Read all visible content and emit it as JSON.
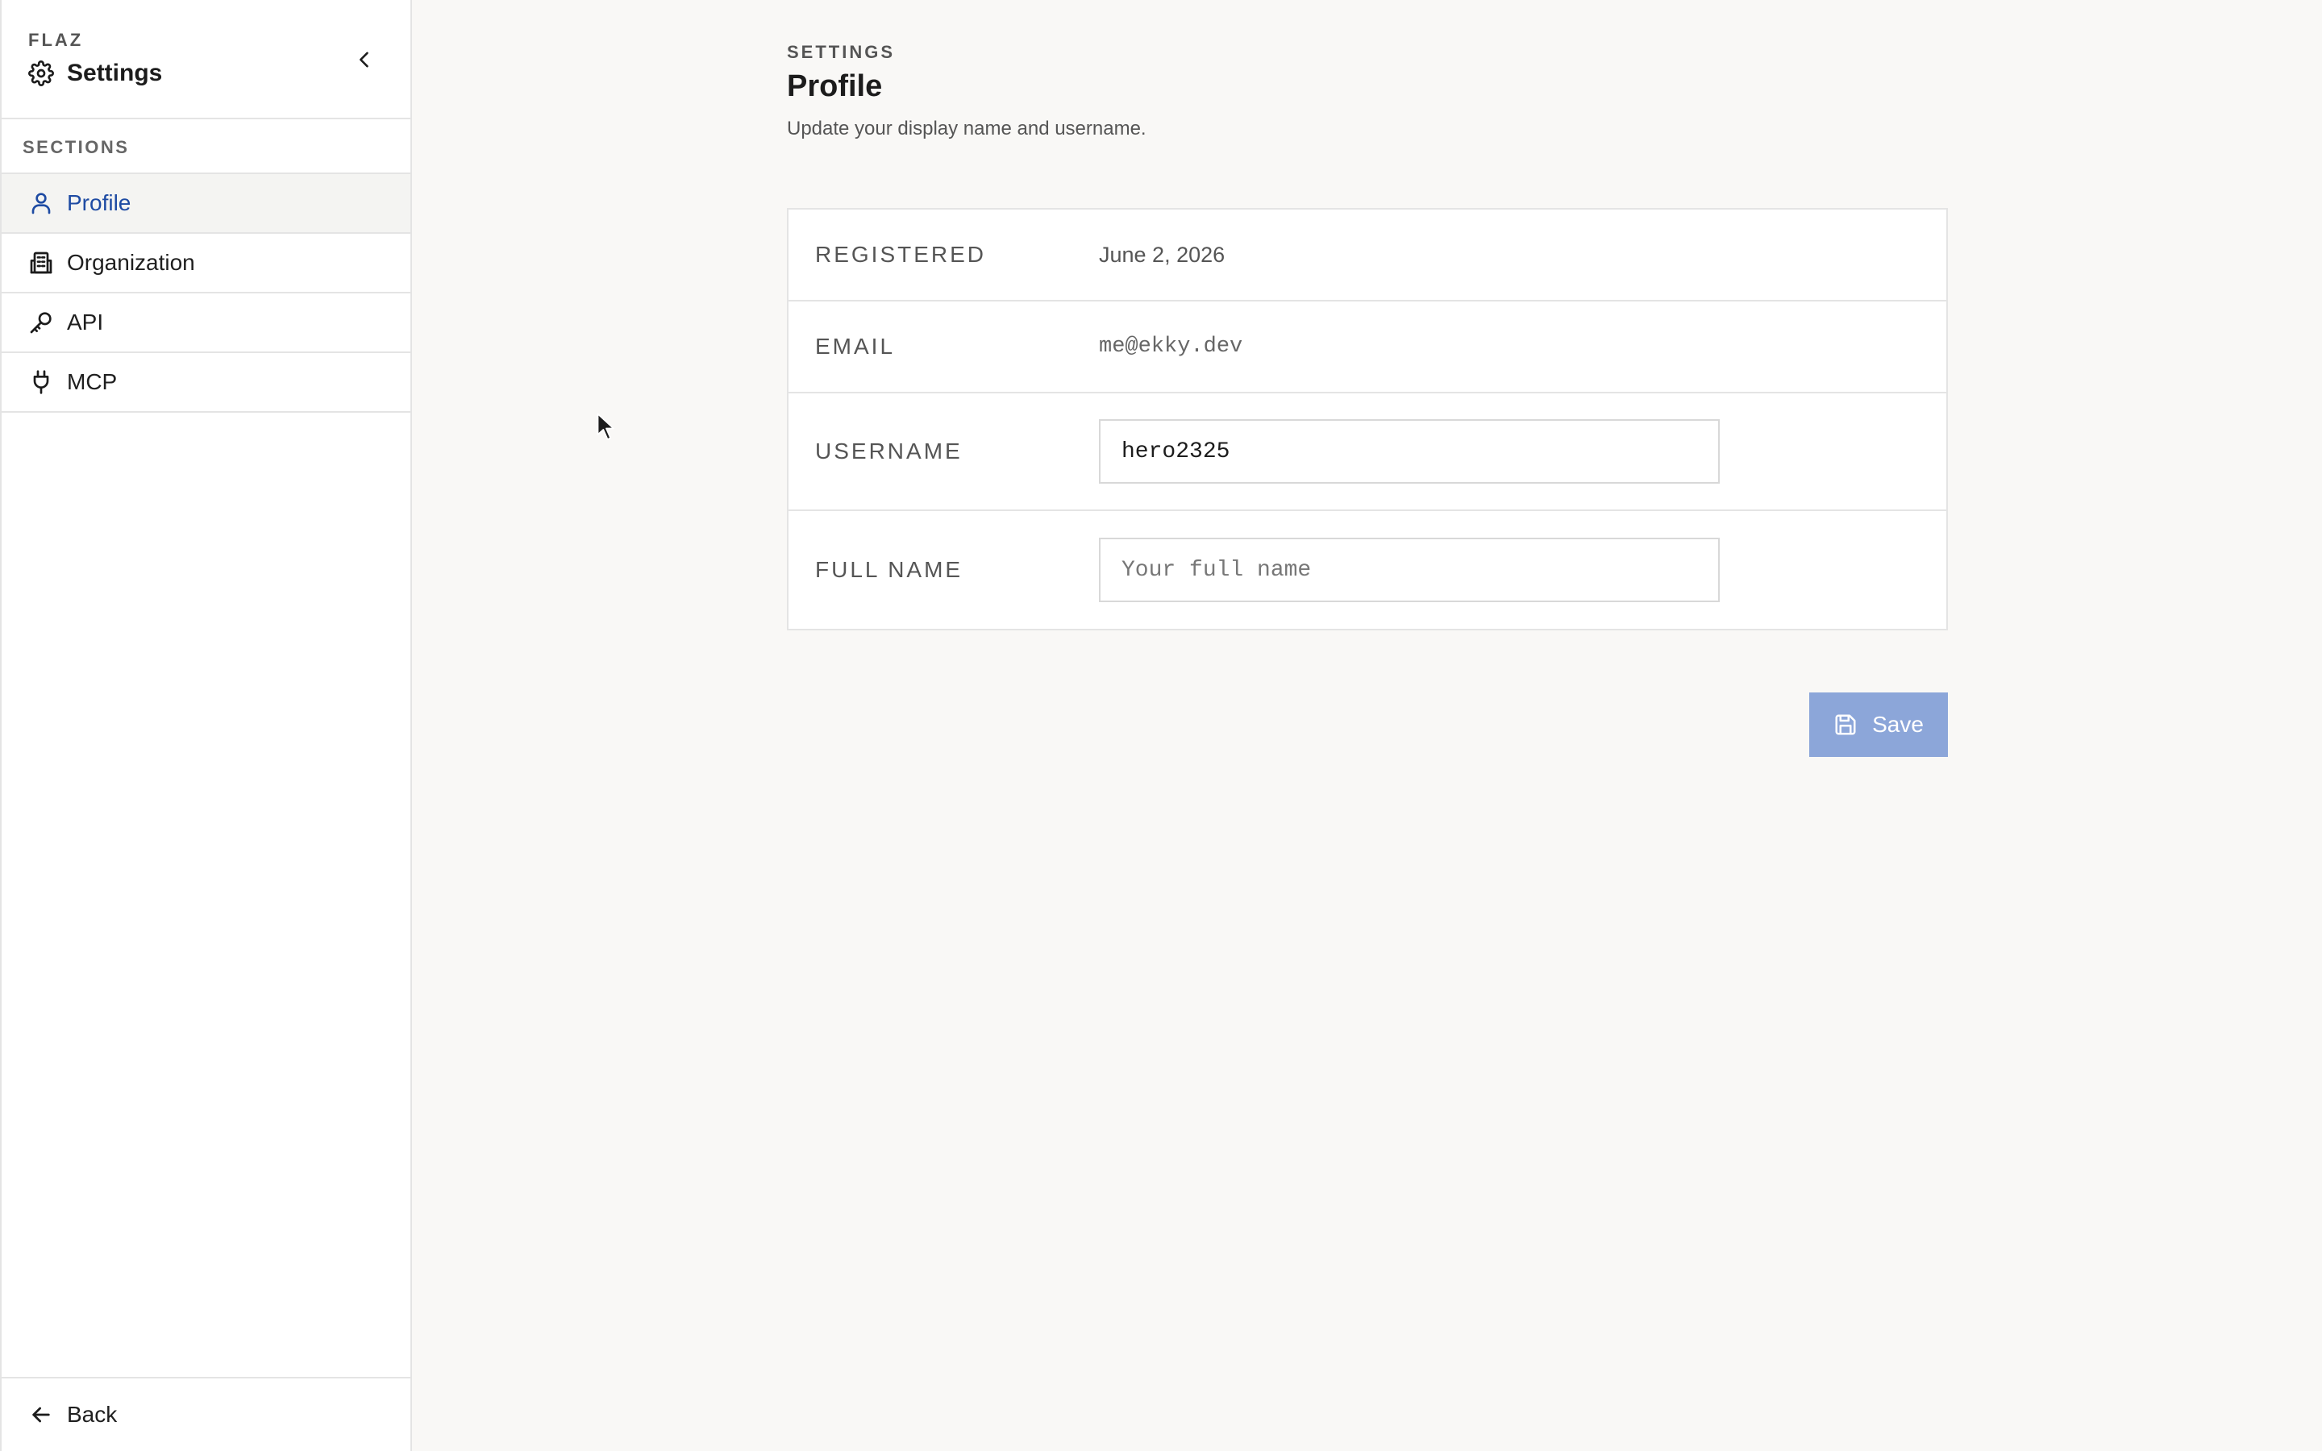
{
  "sidebar": {
    "brand": "FLAZ",
    "title": "Settings",
    "title_icon": "gear-icon",
    "collapse_icon": "chevron-left-icon",
    "section_label": "SECTIONS",
    "items": [
      {
        "label": "Profile",
        "icon": "user-icon",
        "active": true
      },
      {
        "label": "Organization",
        "icon": "building-icon",
        "active": false
      },
      {
        "label": "API",
        "icon": "key-icon",
        "active": false
      },
      {
        "label": "MCP",
        "icon": "plug-icon",
        "active": false
      }
    ],
    "footer": {
      "label": "Back",
      "icon": "arrow-left-icon"
    }
  },
  "main": {
    "eyebrow": "SETTINGS",
    "title": "Profile",
    "subtitle": "Update your display name and username.",
    "fields": {
      "registered": {
        "label": "REGISTERED",
        "value": "June 2, 2026"
      },
      "email": {
        "label": "EMAIL",
        "value": "me@ekky.dev"
      },
      "username": {
        "label": "USERNAME",
        "value": "hero2325",
        "placeholder": ""
      },
      "full_name": {
        "label": "FULL NAME",
        "value": "",
        "placeholder": "Your full name"
      }
    },
    "save_label": "Save",
    "save_icon": "floppy-disk-icon"
  },
  "colors": {
    "accent": "#1e4ba3",
    "button_bg": "#8ca6d9",
    "page_bg": "#f9f8f6",
    "border": "#e4e4e4"
  }
}
